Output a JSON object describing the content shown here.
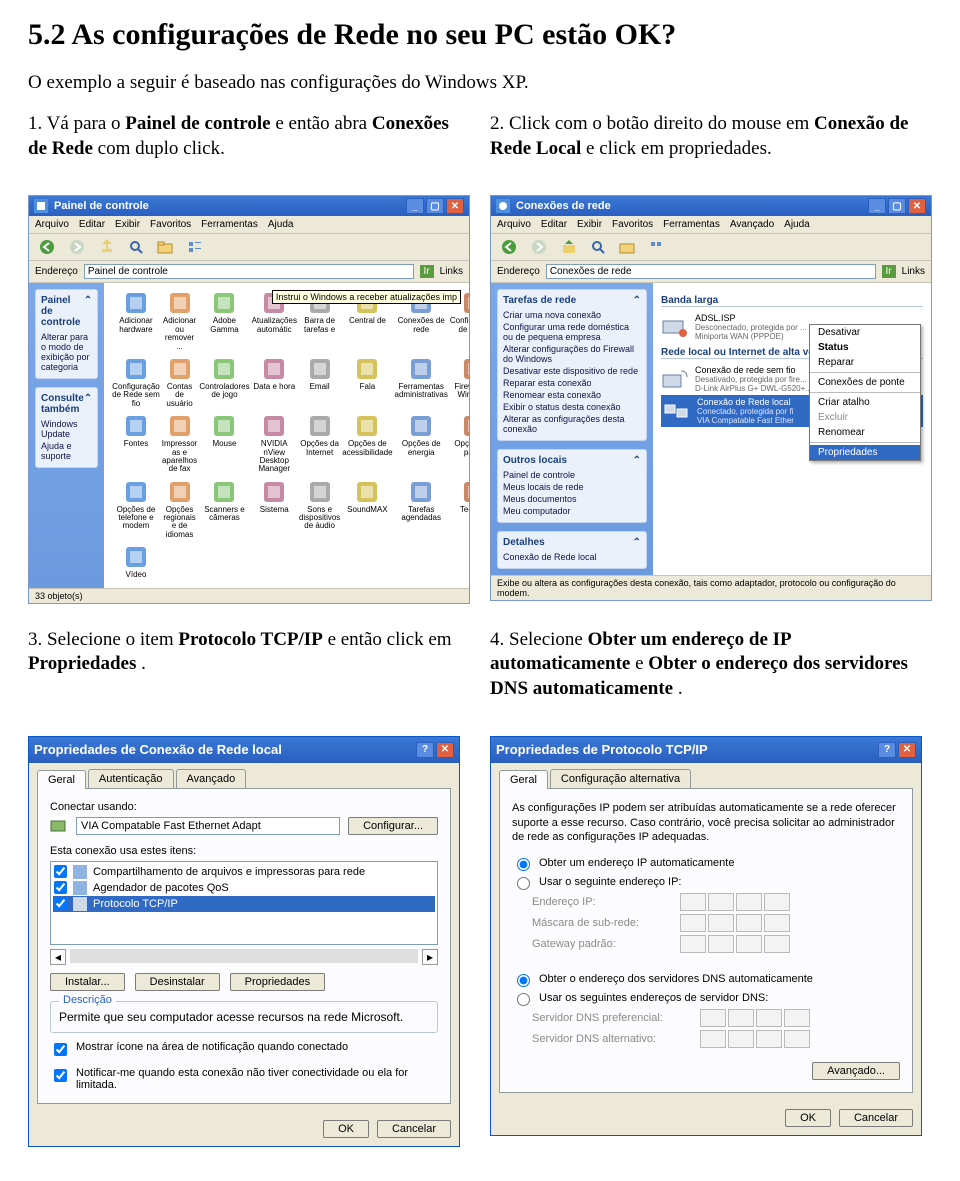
{
  "heading": "5.2 As configurações de Rede no seu PC estão OK?",
  "intro": "O exemplo a seguir é baseado nas configurações do Windows XP.",
  "step1": {
    "num": "1.",
    "body": "Vá para o ",
    "b1": "Painel de controle",
    "mid": " e então abra ",
    "b2": "Conexões de Rede",
    "tail": " com duplo click."
  },
  "step2": {
    "num": "2.",
    "body": "Click com o botão direito do mouse em ",
    "b1": "Conexão de Rede Local",
    "tail": " e click em propriedades."
  },
  "step3": {
    "num": "3.",
    "body": "Selecione o item ",
    "b1": "Protocolo TCP/IP",
    "mid": " e então click em ",
    "b2": "Propriedades",
    "tail": "."
  },
  "step4": {
    "num": "4.",
    "body": "Selecione ",
    "b1": "Obter um endereço de IP automaticamente",
    "mid": " e ",
    "b2": "Obter o endereço dos servidores DNS automaticamente",
    "tail": "."
  },
  "cp": {
    "title": "Painel de controle",
    "menu": [
      "Arquivo",
      "Editar",
      "Exibir",
      "Favoritos",
      "Ferramentas",
      "Ajuda"
    ],
    "addrLabel": "Endereço",
    "addrValue": "Painel de controle",
    "ir": "Ir",
    "links": "Links",
    "panel1": {
      "title": "Painel de controle",
      "link": "Alterar para o modo de exibição por categoria"
    },
    "panel2": {
      "title": "Consulte também",
      "links": [
        "Windows Update",
        "Ajuda e suporte"
      ]
    },
    "icons": [
      "Adicionar hardware",
      "Adicionar ou remover ...",
      "Adobe Gamma",
      "Atualizações automátic",
      "Barra de tarefas e",
      "Central de",
      "Conexões de rede",
      "Configuração de Rede",
      "Configuração de Rede sem fio",
      "Contas de usuário",
      "Controladores de jogo",
      "Data e hora",
      "Email",
      "Fala",
      "Ferramentas administrativas",
      "Firewall do Windows",
      "Fontes",
      "Impressor as e aparelhos de fax",
      "Mouse",
      "NVIDIA nView Desktop Manager",
      "Opções da Internet",
      "Opções de acessibilidade",
      "Opções de energia",
      "Opções de pasta",
      "Opções de telefone e modem",
      "Opções regionais e de idiomas",
      "Scanners e câmeras",
      "Sistema",
      "Sons e dispositivos de áudio",
      "SoundMAX",
      "Tarefas agendadas",
      "Teclado",
      "Vídeo"
    ],
    "status": "33 objeto(s)",
    "tooltip": "Instrui o Windows a receber atualizações imp"
  },
  "nc": {
    "title": "Conexões de rede",
    "menu": [
      "Arquivo",
      "Editar",
      "Exibir",
      "Favoritos",
      "Ferramentas",
      "Avançado",
      "Ajuda"
    ],
    "addrLabel": "Endereço",
    "addrValue": "Conexões de rede",
    "ir": "Ir",
    "links": "Links",
    "tasks": {
      "title": "Tarefas de rede",
      "items": [
        "Criar uma nova conexão",
        "Configurar uma rede doméstica ou de pequena empresa",
        "Alterar configurações do Firewall do Windows",
        "Desativar este dispositivo de rede",
        "Reparar esta conexão",
        "Renomear esta conexão",
        "Exibir o status desta conexão",
        "Alterar as configurações desta conexão"
      ]
    },
    "other": {
      "title": "Outros locais",
      "items": [
        "Painel de controle",
        "Meus locais de rede",
        "Meus documentos",
        "Meu computador"
      ]
    },
    "details": {
      "title": "Detalhes",
      "item": "Conexão de Rede local"
    },
    "group1": "Banda larga",
    "broadband": {
      "name": "ADSL.ISP",
      "sub": "Desconectado, protegida por ...",
      "sub2": "Miniporta WAN (PPPOE)"
    },
    "group2": "Rede local ou Internet de alta velocidade",
    "lan1": {
      "name": "Conexão de rede sem fio",
      "sub": "Desativado, protegida por fire...",
      "sub2": "D-Link AirPlus G+ DWL-G520+..."
    },
    "lan2": {
      "name": "Conexão de Rede local",
      "sub": "Conectado, protegida por fi",
      "sub2": "VIA Compatable Fast Ether"
    },
    "ctx": [
      "Desativar",
      "Status",
      "Reparar",
      "Conexões de ponte",
      "Criar atalho",
      "Excluir",
      "Renomear",
      "Propriedades"
    ],
    "status": "Exibe ou altera as configurações desta conexão, tais como adaptador, protocolo ou configuração do modem."
  },
  "pr": {
    "title": "Propriedades de Conexão de Rede local",
    "tabs": [
      "Geral",
      "Autenticação",
      "Avançado"
    ],
    "connectUsing": "Conectar usando:",
    "adapter": "VIA Compatable Fast Ethernet Adapt",
    "configure": "Configurar...",
    "usesItems": "Esta conexão usa estes itens:",
    "items": [
      "Compartilhamento de arquivos e impressoras para rede",
      "Agendador de pacotes QoS",
      "Protocolo TCP/IP"
    ],
    "install": "Instalar...",
    "uninstall": "Desinstalar",
    "properties": "Propriedades",
    "descLegend": "Descrição",
    "desc": "Permite que seu computador acesse recursos na rede Microsoft.",
    "chk1": "Mostrar ícone na área de notificação quando conectado",
    "chk2": "Notificar-me quando esta conexão não tiver conectividade ou ela for limitada.",
    "ok": "OK",
    "cancel": "Cancelar"
  },
  "tcp": {
    "title": "Propriedades de Protocolo TCP/IP",
    "tabs": [
      "Geral",
      "Configuração alternativa"
    ],
    "note": "As configurações IP podem ser atribuídas automaticamente se a rede oferecer suporte a esse recurso. Caso contrário, você precisa solicitar ao administrador de rede as configurações IP adequadas.",
    "r1": "Obter um endereço IP automaticamente",
    "r2": "Usar o seguinte endereço IP:",
    "ip": "Endereço IP:",
    "mask": "Máscara de sub-rede:",
    "gw": "Gateway padrão:",
    "r3": "Obter o endereço dos servidores DNS automaticamente",
    "r4": "Usar os seguintes endereços de servidor DNS:",
    "dns1": "Servidor DNS preferencial:",
    "dns2": "Servidor DNS alternativo:",
    "adv": "Avançado...",
    "ok": "OK",
    "cancel": "Cancelar"
  }
}
